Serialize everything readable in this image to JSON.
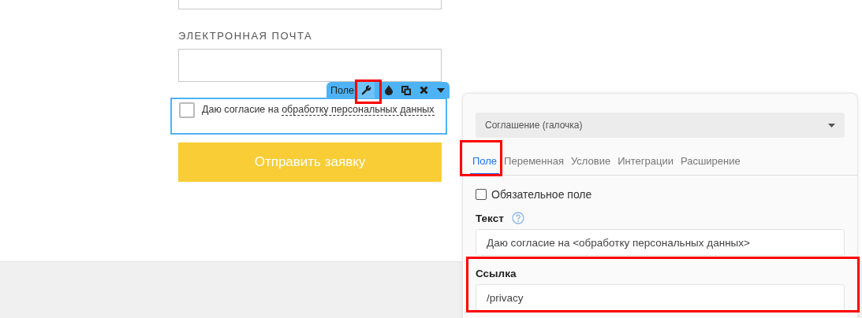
{
  "form": {
    "email_label": "ЭЛЕКТРОННАЯ ПОЧТА",
    "consent": {
      "checked": false,
      "text": "Даю согласие на ",
      "link": "обработку персональных данных",
      "selected": true
    },
    "submit": "Отправить заявку"
  },
  "field_toolbar": {
    "label": "Поле",
    "tools": [
      {
        "kind": "settings",
        "selected": true
      },
      {
        "kind": "drop",
        "selected": false
      },
      {
        "kind": "copy",
        "selected": false
      },
      {
        "kind": "delete",
        "selected": false
      },
      {
        "kind": "caret",
        "selected": false
      }
    ]
  },
  "panel": {
    "type_select": "Соглашение (галочка)",
    "tabs": [
      {
        "label": "Поле",
        "selected": true
      },
      {
        "label": "Переменная",
        "selected": false
      },
      {
        "label": "Условие",
        "selected": false
      },
      {
        "label": "Интеграции",
        "selected": false
      },
      {
        "label": "Расширение",
        "selected": false
      }
    ],
    "required": {
      "label": "Обязательное поле",
      "checked": false
    },
    "text_label": "Текст",
    "text_value": "Даю согласие на <обработку персональных данных>",
    "link_label": "Ссылка",
    "link_value": "/privacy"
  }
}
